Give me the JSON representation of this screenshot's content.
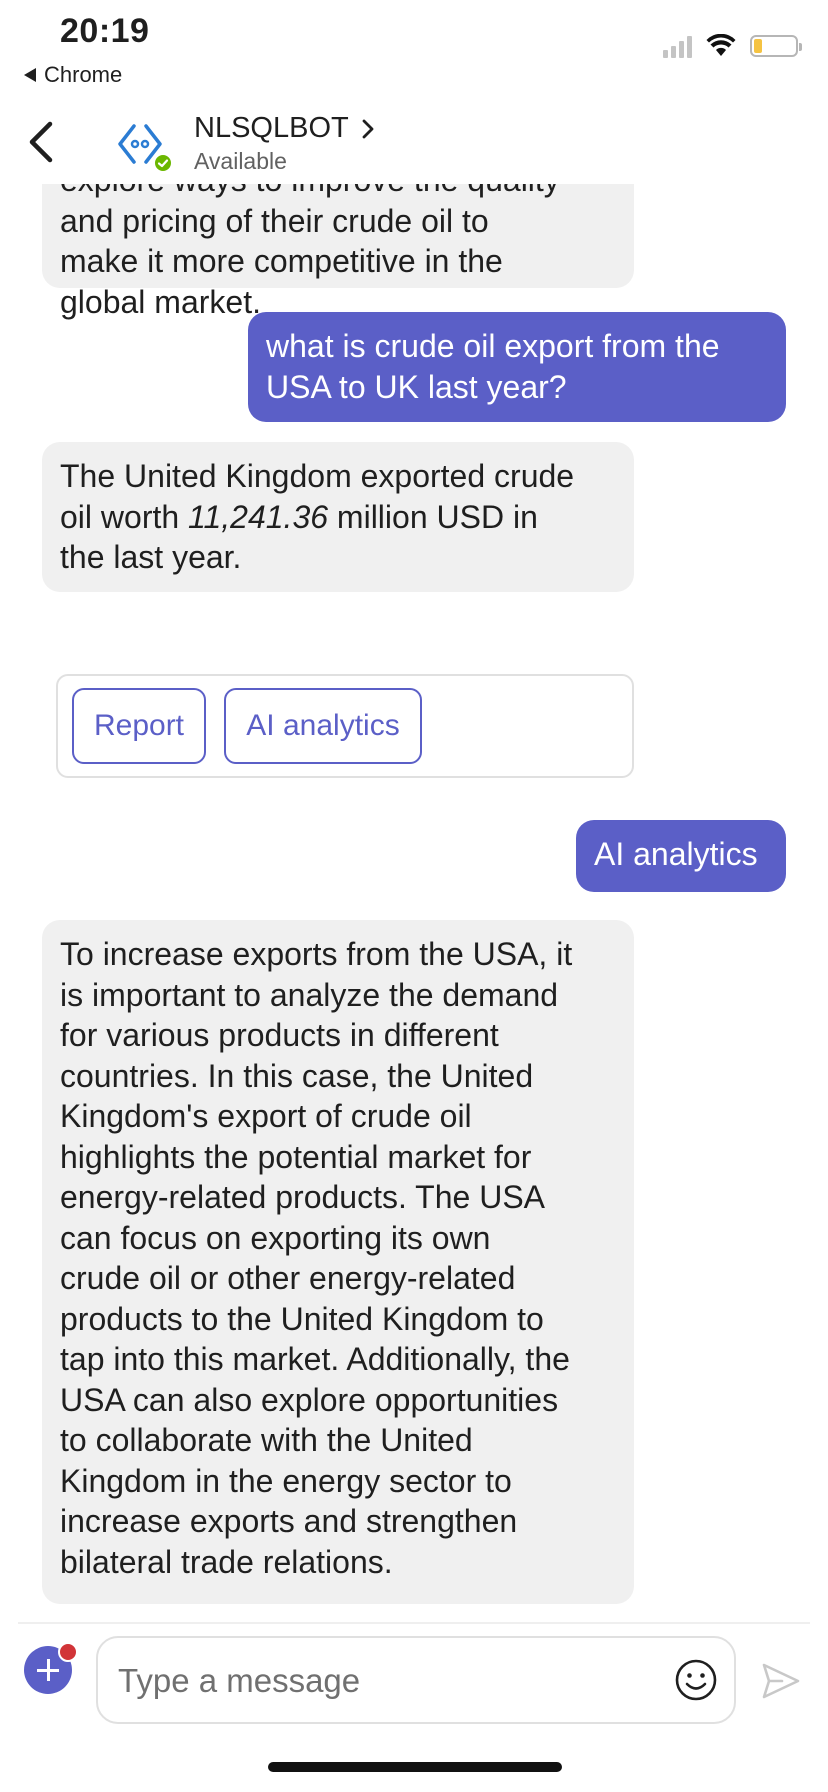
{
  "status_bar": {
    "time": "20:19",
    "back_app": "Chrome"
  },
  "header": {
    "bot_name": "NLSQLBOT",
    "bot_status": "Available"
  },
  "messages": {
    "m1": {
      "line0": "explore ways to improve the quality",
      "line1": "and pricing of their crude oil to",
      "line2": "make it more competitive in the",
      "line3": "global market."
    },
    "m2": {
      "line1": "what is crude oil export from the",
      "line2": "USA to UK last year?"
    },
    "m3": {
      "line1": "The United Kingdom exported crude",
      "line2_pre": "oil worth ",
      "line2_value": "11,241.36",
      "line2_post": " million USD in",
      "line3": "the last year."
    },
    "card": {
      "report_label": "Report",
      "ai_label": "AI analytics"
    },
    "m4": {
      "text": "AI analytics"
    },
    "m5": {
      "lines": [
        "To increase exports from the USA, it",
        "is important to analyze the demand",
        "for various products in different",
        "countries. In this case, the United",
        "Kingdom's export of crude oil",
        "highlights the potential market for",
        "energy-related products. The USA",
        "can focus on exporting its own",
        "crude oil or other energy-related",
        "products to the United Kingdom to",
        "tap into this market. Additionally, the",
        "USA can also explore opportunities",
        "to collaborate with the United",
        "Kingdom in the energy sector to",
        "increase exports and strengthen",
        "bilateral trade relations."
      ]
    }
  },
  "compose": {
    "placeholder": "Type a message"
  },
  "colors": {
    "accent": "#5b5fc7",
    "bubble_in": "#f0f0f0",
    "presence": "#6bb700",
    "notification": "#d13438"
  },
  "icons": {
    "back": "chevron-left-icon",
    "bot": "bot-avatar-icon",
    "emoji": "emoji-icon",
    "send": "send-icon",
    "add": "plus-icon"
  }
}
